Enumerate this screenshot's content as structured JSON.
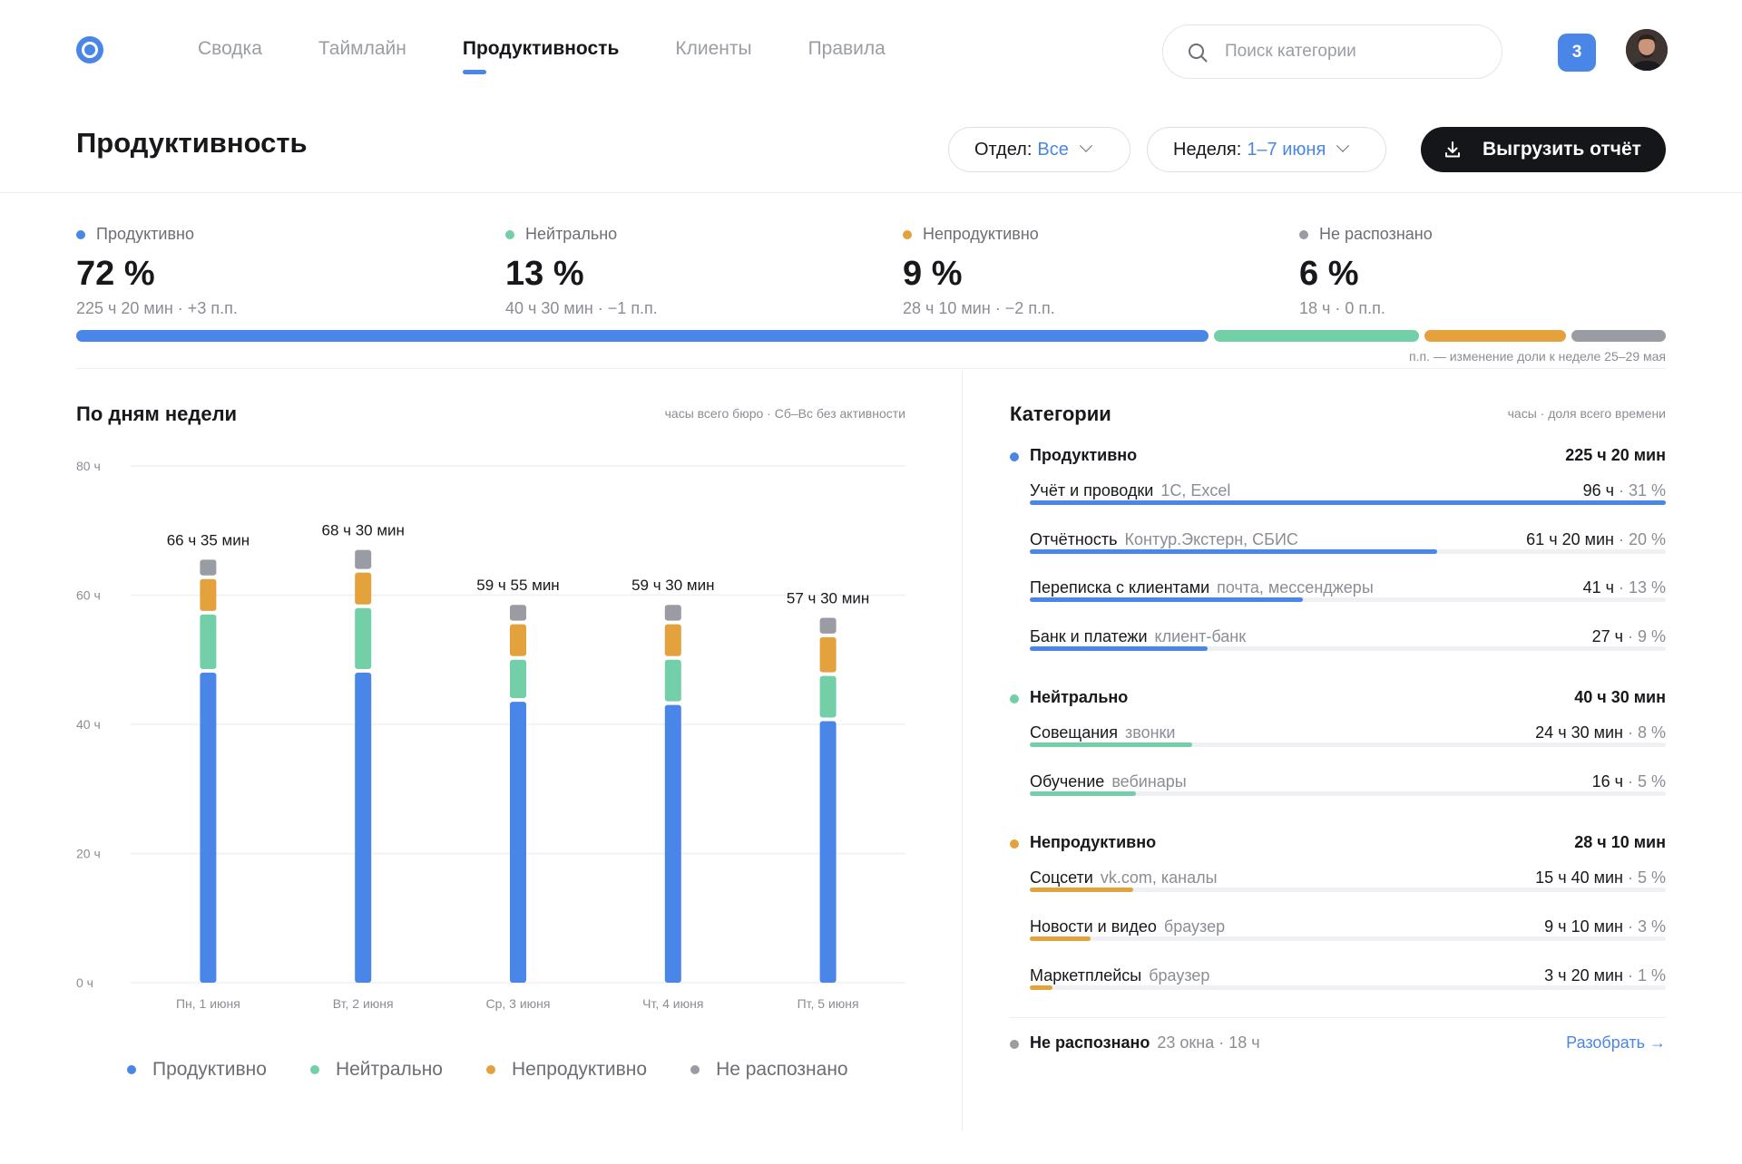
{
  "colors": {
    "accent": "#4a86e8",
    "productive": "#4a86e8",
    "neutral": "#72cfa7",
    "unproductive": "#e3a23c",
    "unrecognized": "#9a9ca3"
  },
  "nav": {
    "items": [
      {
        "label": "Сводка",
        "active": false
      },
      {
        "label": "Таймлайн",
        "active": false
      },
      {
        "label": "Продуктивность",
        "active": true
      },
      {
        "label": "Клиенты",
        "active": false
      },
      {
        "label": "Правила",
        "active": false
      }
    ],
    "search_placeholder": "Поиск категории",
    "notifications_count": "3"
  },
  "page": {
    "title": "Продуктивность",
    "dept_label": "Отдел:",
    "dept_value": "Все",
    "week_label": "Неделя:",
    "week_value": "1–7 июня",
    "export_label": "Выгрузить отчёт"
  },
  "kpis": [
    {
      "label": "Продуктивно",
      "value": "72 %",
      "sub": "225 ч 20 мин · +3 п.п.",
      "share": 72
    },
    {
      "label": "Нейтрально",
      "value": "13 %",
      "sub": "40 ч 30 мин · −1 п.п.",
      "share": 13
    },
    {
      "label": "Непродуктивно",
      "value": "9 %",
      "sub": "28 ч 10 мин · −2 п.п.",
      "share": 9
    },
    {
      "label": "Не распознано",
      "value": "6 %",
      "sub": "18 ч · 0 п.п.",
      "share": 6
    }
  ],
  "share_note": "п.п. — изменение доли к неделе 25–29 мая",
  "chart_panel": {
    "title": "По дням недели",
    "note": "часы всего бюро · Сб–Вс без активности"
  },
  "chart_data": {
    "type": "bar",
    "stacked": true,
    "categories": [
      "Пн, 1 июня",
      "Вт, 2 июня",
      "Ср, 3 июня",
      "Чт, 4 июня",
      "Пт, 5 июня"
    ],
    "totals_labels": [
      "66 ч 35 мин",
      "68 ч 30 мин",
      "59 ч 55 мин",
      "59 ч 30 мин",
      "57 ч 30 мин"
    ],
    "series": [
      {
        "name": "Продуктивно",
        "values": [
          48,
          48,
          43.5,
          43,
          40.5
        ]
      },
      {
        "name": "Нейтрально",
        "values": [
          9,
          10,
          6.5,
          7,
          7
        ]
      },
      {
        "name": "Непродуктивно",
        "values": [
          5.5,
          5.5,
          5.5,
          5.5,
          6
        ]
      },
      {
        "name": "Не распознано",
        "values": [
          3,
          3.5,
          3,
          3,
          3
        ]
      }
    ],
    "y_ticks": [
      "0 ч",
      "20 ч",
      "40 ч",
      "60 ч",
      "80 ч"
    ],
    "ylim": [
      0,
      80
    ],
    "grid": true,
    "legend": "bottom"
  },
  "categories_panel": {
    "title": "Категории",
    "note": "часы · доля всего времени",
    "groups": [
      {
        "name": "Продуктивно",
        "total": "225 ч 20 мин",
        "items": [
          {
            "name": "Учёт и проводки",
            "apps": "1С, Excel",
            "hours": "96 ч",
            "pct": "31 %",
            "fill": 1.0
          },
          {
            "name": "Отчётность",
            "apps": "Контур.Экстерн, СБИС",
            "hours": "61 ч 20 мин",
            "pct": "20 %",
            "fill": 0.64
          },
          {
            "name": "Переписка с клиентами",
            "apps": "почта, мессенджеры",
            "hours": "41 ч",
            "pct": "13 %",
            "fill": 0.43
          },
          {
            "name": "Банк и платежи",
            "apps": "клиент-банк",
            "hours": "27 ч",
            "pct": "9 %",
            "fill": 0.28
          }
        ]
      },
      {
        "name": "Нейтрально",
        "total": "40 ч 30 мин",
        "items": [
          {
            "name": "Совещания",
            "apps": "звонки",
            "hours": "24 ч 30 мин",
            "pct": "8 %",
            "fill": 0.255
          },
          {
            "name": "Обучение",
            "apps": "вебинары",
            "hours": "16 ч",
            "pct": "5 %",
            "fill": 0.167
          }
        ]
      },
      {
        "name": "Непродуктивно",
        "total": "28 ч 10 мин",
        "items": [
          {
            "name": "Соцсети",
            "apps": "vk.com, каналы",
            "hours": "15 ч 40 мин",
            "pct": "5 %",
            "fill": 0.163
          },
          {
            "name": "Новости и видео",
            "apps": "браузер",
            "hours": "9 ч 10 мин",
            "pct": "3 %",
            "fill": 0.096
          },
          {
            "name": "Маркетплейсы",
            "apps": "браузер",
            "hours": "3 ч 20 мин",
            "pct": "1 %",
            "fill": 0.035
          }
        ]
      }
    ],
    "unrecognized": {
      "name": "Не распознано",
      "meta": "23 окна · 18 ч",
      "link": "Разобрать →"
    }
  }
}
